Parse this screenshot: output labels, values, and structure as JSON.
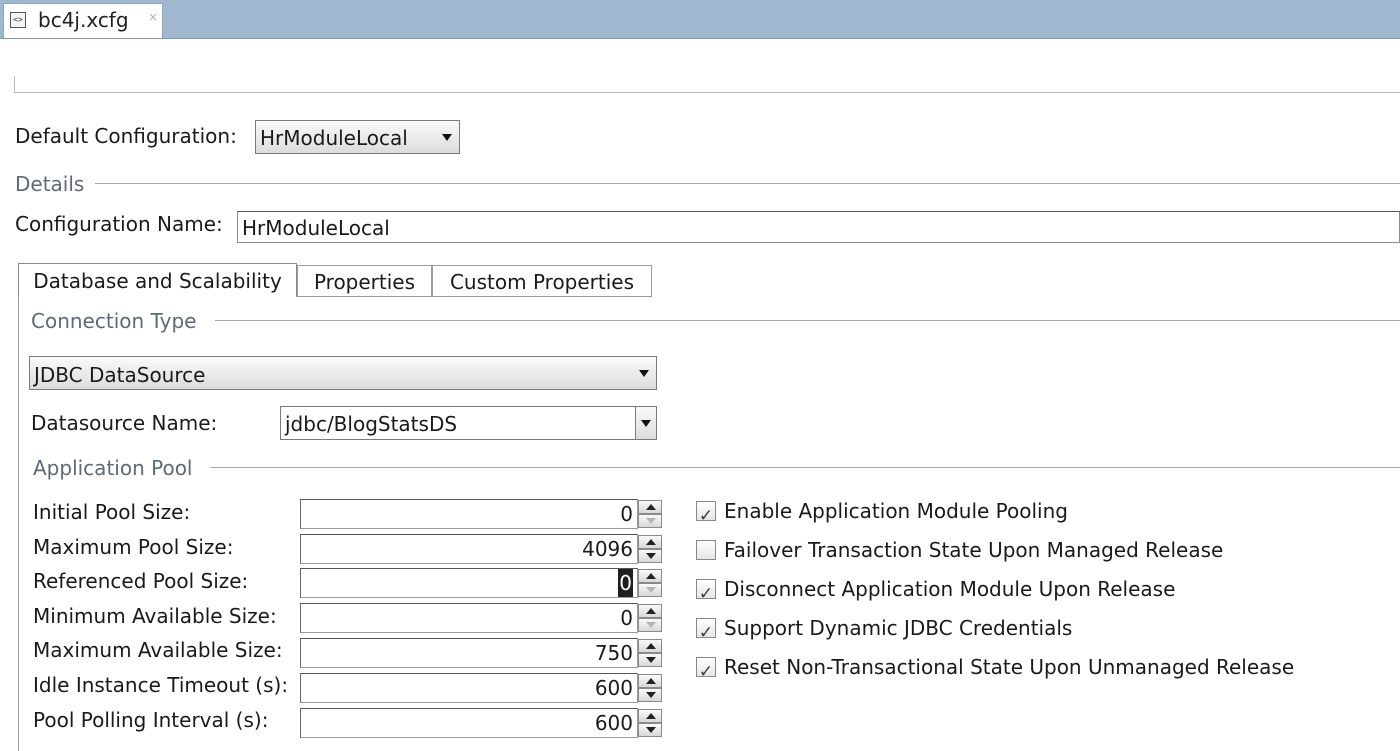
{
  "editor_tab": {
    "title": "bc4j.xcfg",
    "icon": "xml-file-icon",
    "close": "×"
  },
  "default_configuration": {
    "label": "Default Configuration:",
    "value": "HrModuleLocal"
  },
  "details": {
    "title": "Details",
    "configuration_name_label": "Configuration Name:",
    "configuration_name_value": "HrModuleLocal"
  },
  "tabs": [
    {
      "label": "Database and Scalability",
      "active": true
    },
    {
      "label": "Properties",
      "active": false
    },
    {
      "label": "Custom Properties",
      "active": false
    }
  ],
  "connection": {
    "title": "Connection Type",
    "type_value": "JDBC DataSource",
    "datasource_label": "Datasource Name:",
    "datasource_value": "jdbc/BlogStatsDS"
  },
  "pool": {
    "title": "Application Pool",
    "fields": [
      {
        "label": "Initial Pool Size:",
        "value": "0",
        "down_disabled": true
      },
      {
        "label": "Maximum Pool Size:",
        "value": "4096",
        "down_disabled": false
      },
      {
        "label": "Referenced Pool Size:",
        "value": "0",
        "selected": true,
        "down_disabled": true
      },
      {
        "label": "Minimum Available Size:",
        "value": "0",
        "down_disabled": true
      },
      {
        "label": "Maximum Available Size:",
        "value": "750",
        "down_disabled": false
      },
      {
        "label": "Idle Instance Timeout (s):",
        "value": "600",
        "down_disabled": false
      },
      {
        "label": "Pool Polling Interval (s):",
        "value": "600",
        "down_disabled": false
      }
    ],
    "options": [
      {
        "label": "Enable Application Module Pooling",
        "checked": true
      },
      {
        "label": "Failover Transaction State Upon Managed Release",
        "checked": false
      },
      {
        "label": "Disconnect Application Module Upon Release",
        "checked": true
      },
      {
        "label": "Support Dynamic JDBC Credentials",
        "checked": true
      },
      {
        "label": "Reset Non-Transactional State Upon Unmanaged Release",
        "checked": true
      }
    ]
  }
}
